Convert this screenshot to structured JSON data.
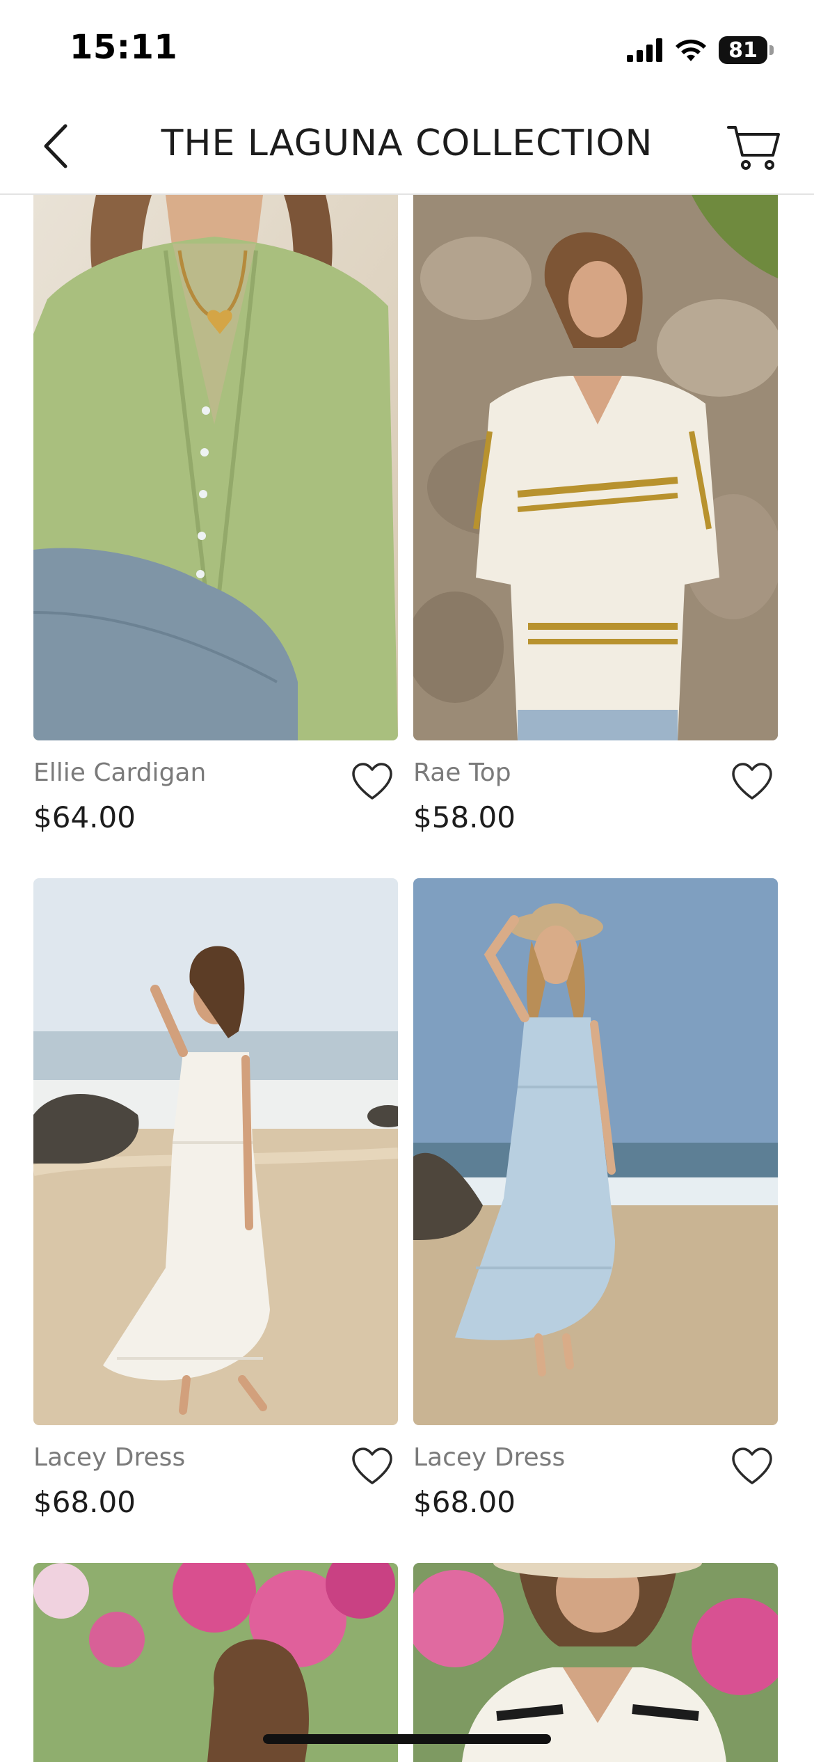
{
  "status_bar": {
    "time": "15:11",
    "battery": "81"
  },
  "nav": {
    "title": "THE LAGUNA COLLECTION"
  },
  "products": [
    {
      "name": "Ellie Cardigan",
      "price": "$64.00"
    },
    {
      "name": "Rae Top",
      "price": "$58.00"
    },
    {
      "name": "Lacey Dress",
      "price": "$68.00"
    },
    {
      "name": "Lacey Dress",
      "price": "$68.00"
    }
  ],
  "icons": {
    "back": "chevron-left-icon",
    "cart": "cart-icon",
    "favorite": "heart-outline-icon"
  },
  "colors": {
    "text_primary": "#1c1c1c",
    "text_secondary": "#7a7a7a",
    "divider": "#e3e3e3"
  }
}
